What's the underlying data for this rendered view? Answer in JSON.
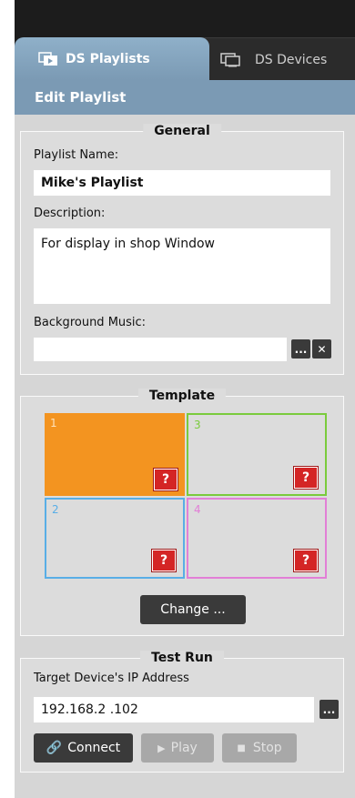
{
  "tabs": [
    {
      "label": "DS Playlists",
      "icon": "playlist-icon",
      "active": true
    },
    {
      "label": "DS Devices",
      "icon": "devices-icon",
      "active": false
    }
  ],
  "subheader": "Edit Playlist",
  "general": {
    "title": "General",
    "playlist_name_label": "Playlist Name:",
    "playlist_name_value": "Mike's Playlist",
    "description_label": "Description:",
    "description_value": "For display in shop Window",
    "music_label": "Background Music:",
    "music_value": "",
    "browse_label": "...",
    "clear_label": "✕"
  },
  "template": {
    "title": "Template",
    "cells": [
      {
        "num": "1",
        "color": "#f39420",
        "filled": true
      },
      {
        "num": "3",
        "color": "#7acb3c",
        "filled": false
      },
      {
        "num": "2",
        "color": "#59aee6",
        "filled": false
      },
      {
        "num": "4",
        "color": "#e27fd6",
        "filled": false
      }
    ],
    "question_mark": "?",
    "change_label": "Change ..."
  },
  "test_run": {
    "title": "Test Run",
    "ip_label": "Target Device's IP Address",
    "ip_value": "192.168.2 .102",
    "browse_label": "...",
    "connect_label": "Connect",
    "play_label": "Play",
    "stop_label": "Stop"
  }
}
